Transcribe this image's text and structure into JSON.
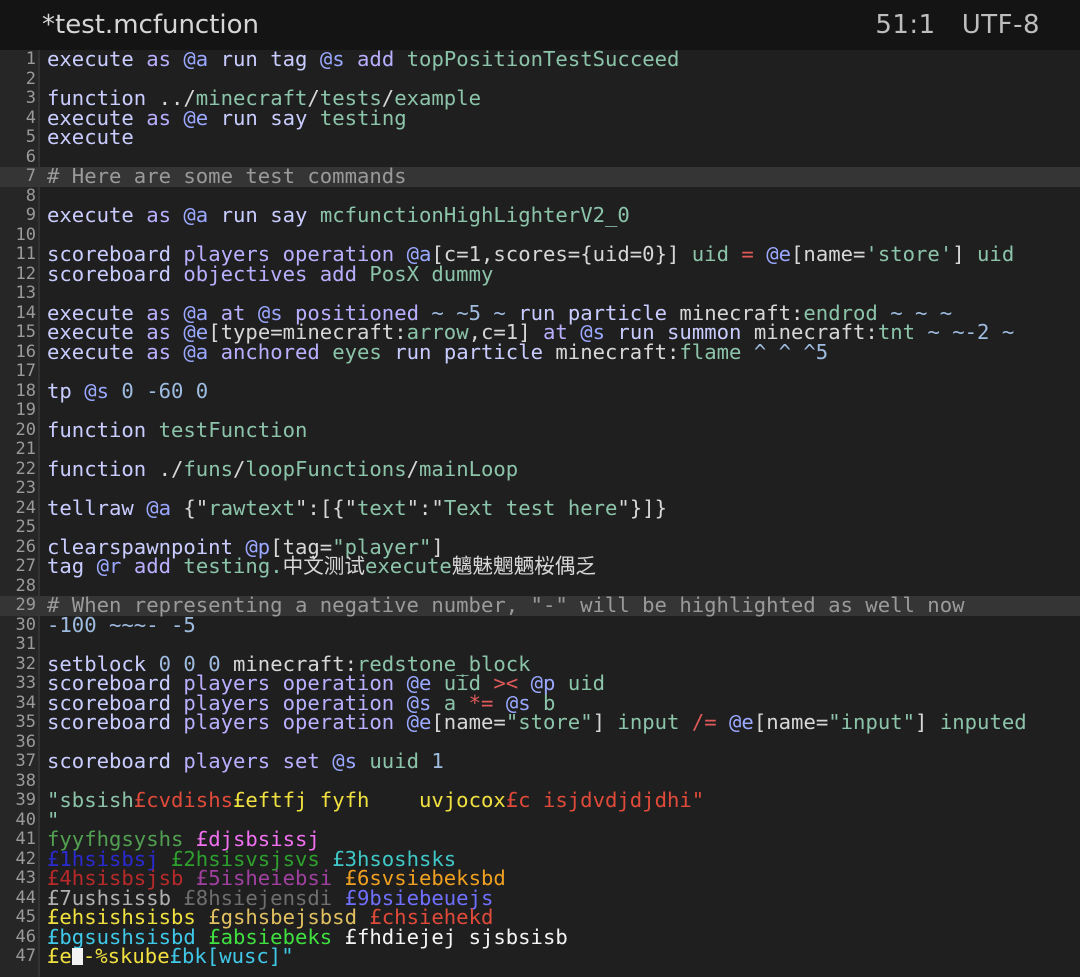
{
  "topbar": {
    "title": "*test.mcfunction",
    "position": "51:1",
    "encoding": "UTF-8"
  },
  "colors": {
    "keyword": "#b8b0ff",
    "command": "#ced2ff",
    "selector": "#9aa8ff",
    "func": "#8cc4aa",
    "number": "#9ebce0",
    "string": "#d2d2d2",
    "operator": "#e05a5a",
    "comment": "#a0a0a0"
  },
  "lines": [
    {
      "n": 1,
      "segs": [
        [
          "execute ",
          "#c9ccff"
        ],
        [
          "as ",
          "#b8b0ff"
        ],
        [
          "@a ",
          "#9aa8ff"
        ],
        [
          "run ",
          "#c9ccff"
        ],
        [
          "tag ",
          "#c9ccff"
        ],
        [
          "@s ",
          "#9aa8ff"
        ],
        [
          "add ",
          "#b8b0ff"
        ],
        [
          "topPositionTestSucceed",
          "#8cc4aa"
        ]
      ]
    },
    {
      "n": 2,
      "segs": []
    },
    {
      "n": 3,
      "segs": [
        [
          "function ",
          "#c9ccff"
        ],
        [
          "../",
          "#d7d7d7"
        ],
        [
          "minecraft",
          "#8cc4aa"
        ],
        [
          "/",
          "#d7d7d7"
        ],
        [
          "tests",
          "#8cc4aa"
        ],
        [
          "/",
          "#d7d7d7"
        ],
        [
          "example",
          "#8cc4aa"
        ]
      ]
    },
    {
      "n": 4,
      "segs": [
        [
          "execute ",
          "#c9ccff"
        ],
        [
          "as ",
          "#b8b0ff"
        ],
        [
          "@e ",
          "#9aa8ff"
        ],
        [
          "run ",
          "#c9ccff"
        ],
        [
          "say ",
          "#c9ccff"
        ],
        [
          "testing",
          "#8cc4aa"
        ]
      ]
    },
    {
      "n": 5,
      "segs": [
        [
          "execute",
          "#c9ccff"
        ]
      ]
    },
    {
      "n": 6,
      "segs": []
    },
    {
      "n": 7,
      "hl": true,
      "segs": [
        [
          "# Here are some test commands",
          "#9a9a9a"
        ]
      ]
    },
    {
      "n": 8,
      "segs": []
    },
    {
      "n": 9,
      "segs": [
        [
          "execute ",
          "#c9ccff"
        ],
        [
          "as ",
          "#b8b0ff"
        ],
        [
          "@a ",
          "#9aa8ff"
        ],
        [
          "run ",
          "#c9ccff"
        ],
        [
          "say ",
          "#c9ccff"
        ],
        [
          "mcfunctionHighLighterV2_0",
          "#8cc4aa"
        ]
      ]
    },
    {
      "n": 10,
      "segs": []
    },
    {
      "n": 11,
      "segs": [
        [
          "scoreboard ",
          "#c9ccff"
        ],
        [
          "players ",
          "#b8b0ff"
        ],
        [
          "operation ",
          "#b8b0ff"
        ],
        [
          "@a",
          "#9aa8ff"
        ],
        [
          "[c=1,scores={uid=0}] ",
          "#d7d7d7"
        ],
        [
          "uid ",
          "#8cc4aa"
        ],
        [
          "= ",
          "#e05a5a"
        ],
        [
          "@e",
          "#9aa8ff"
        ],
        [
          "[name=",
          "#d7d7d7"
        ],
        [
          "'store'",
          "#8cc4aa"
        ],
        [
          "] ",
          "#d7d7d7"
        ],
        [
          "uid",
          "#8cc4aa"
        ]
      ]
    },
    {
      "n": 12,
      "segs": [
        [
          "scoreboard ",
          "#c9ccff"
        ],
        [
          "objectives ",
          "#b8b0ff"
        ],
        [
          "add ",
          "#b8b0ff"
        ],
        [
          "PosX dummy",
          "#8cc4aa"
        ]
      ]
    },
    {
      "n": 13,
      "segs": []
    },
    {
      "n": 14,
      "segs": [
        [
          "execute ",
          "#c9ccff"
        ],
        [
          "as ",
          "#b8b0ff"
        ],
        [
          "@a ",
          "#9aa8ff"
        ],
        [
          "at ",
          "#b8b0ff"
        ],
        [
          "@s ",
          "#9aa8ff"
        ],
        [
          "positioned ",
          "#b8b0ff"
        ],
        [
          "~ ~5 ~ ",
          "#9ebce0"
        ],
        [
          "run ",
          "#c9ccff"
        ],
        [
          "particle ",
          "#c9ccff"
        ],
        [
          "minecraft:",
          "#d7d7d7"
        ],
        [
          "endrod ",
          "#8cc4aa"
        ],
        [
          "~ ~ ~",
          "#9ebce0"
        ]
      ]
    },
    {
      "n": 15,
      "segs": [
        [
          "execute ",
          "#c9ccff"
        ],
        [
          "as ",
          "#b8b0ff"
        ],
        [
          "@e",
          "#9aa8ff"
        ],
        [
          "[type=minecraft:",
          "#d7d7d7"
        ],
        [
          "arrow",
          "#8cc4aa"
        ],
        [
          ",c=1] ",
          "#d7d7d7"
        ],
        [
          "at ",
          "#b8b0ff"
        ],
        [
          "@s ",
          "#9aa8ff"
        ],
        [
          "run ",
          "#c9ccff"
        ],
        [
          "summon ",
          "#c9ccff"
        ],
        [
          "minecraft:",
          "#d7d7d7"
        ],
        [
          "tnt ",
          "#8cc4aa"
        ],
        [
          "~ ~-2 ~",
          "#9ebce0"
        ]
      ]
    },
    {
      "n": 16,
      "segs": [
        [
          "execute ",
          "#c9ccff"
        ],
        [
          "as ",
          "#b8b0ff"
        ],
        [
          "@a ",
          "#9aa8ff"
        ],
        [
          "anchored ",
          "#b8b0ff"
        ],
        [
          "eyes ",
          "#8cc4aa"
        ],
        [
          "run ",
          "#c9ccff"
        ],
        [
          "particle ",
          "#c9ccff"
        ],
        [
          "minecraft:",
          "#d7d7d7"
        ],
        [
          "flame ",
          "#8cc4aa"
        ],
        [
          "^ ^ ^5",
          "#9ebce0"
        ]
      ]
    },
    {
      "n": 17,
      "segs": []
    },
    {
      "n": 18,
      "segs": [
        [
          "tp ",
          "#c9ccff"
        ],
        [
          "@s ",
          "#9aa8ff"
        ],
        [
          "0 -60 0",
          "#9ebce0"
        ]
      ]
    },
    {
      "n": 19,
      "segs": []
    },
    {
      "n": 20,
      "segs": [
        [
          "function ",
          "#c9ccff"
        ],
        [
          "testFunction",
          "#8cc4aa"
        ]
      ]
    },
    {
      "n": 21,
      "segs": []
    },
    {
      "n": 22,
      "segs": [
        [
          "function ",
          "#c9ccff"
        ],
        [
          "./",
          "#d7d7d7"
        ],
        [
          "funs",
          "#8cc4aa"
        ],
        [
          "/",
          "#d7d7d7"
        ],
        [
          "loopFunctions",
          "#8cc4aa"
        ],
        [
          "/",
          "#d7d7d7"
        ],
        [
          "mainLoop",
          "#8cc4aa"
        ]
      ]
    },
    {
      "n": 23,
      "segs": []
    },
    {
      "n": 24,
      "segs": [
        [
          "tellraw ",
          "#c9ccff"
        ],
        [
          "@a ",
          "#9aa8ff"
        ],
        [
          "{\"",
          "#d7d7d7"
        ],
        [
          "rawtext",
          "#8cc4aa"
        ],
        [
          "\":[{\"",
          "#d7d7d7"
        ],
        [
          "text",
          "#8cc4aa"
        ],
        [
          "\":\"",
          "#d7d7d7"
        ],
        [
          "Text test here",
          "#8cc4aa"
        ],
        [
          "\"}]}",
          "#d7d7d7"
        ]
      ]
    },
    {
      "n": 25,
      "segs": []
    },
    {
      "n": 26,
      "segs": [
        [
          "clearspawnpoint ",
          "#c9ccff"
        ],
        [
          "@p",
          "#9aa8ff"
        ],
        [
          "[tag=",
          "#d7d7d7"
        ],
        [
          "\"player\"",
          "#8cc4aa"
        ],
        [
          "]",
          "#d7d7d7"
        ]
      ]
    },
    {
      "n": 27,
      "segs": [
        [
          "tag ",
          "#c9ccff"
        ],
        [
          "@r ",
          "#9aa8ff"
        ],
        [
          "add ",
          "#b8b0ff"
        ],
        [
          "testing.",
          "#8cc4aa"
        ],
        [
          "中文测试",
          "#d7d7d7"
        ],
        [
          "execute",
          "#8cc4aa"
        ],
        [
          "魑魅魍魉桜偶乏",
          "#d7d7d7"
        ]
      ]
    },
    {
      "n": 28,
      "segs": []
    },
    {
      "n": 29,
      "hl": true,
      "segs": [
        [
          "# When representing a negative number, \"-\" will be highlighted as well now",
          "#9a9a9a"
        ]
      ]
    },
    {
      "n": 30,
      "segs": [
        [
          "-100 ~~~- -5",
          "#9ebce0"
        ]
      ]
    },
    {
      "n": 31,
      "segs": []
    },
    {
      "n": 32,
      "segs": [
        [
          "setblock ",
          "#c9ccff"
        ],
        [
          "0 0 0 ",
          "#9ebce0"
        ],
        [
          "minecraft:",
          "#d7d7d7"
        ],
        [
          "redstone_block",
          "#8cc4aa"
        ]
      ]
    },
    {
      "n": 33,
      "segs": [
        [
          "scoreboard ",
          "#c9ccff"
        ],
        [
          "players ",
          "#b8b0ff"
        ],
        [
          "operation ",
          "#b8b0ff"
        ],
        [
          "@e ",
          "#9aa8ff"
        ],
        [
          "uid ",
          "#8cc4aa"
        ],
        [
          ">< ",
          "#e05a5a"
        ],
        [
          "@p ",
          "#9aa8ff"
        ],
        [
          "uid",
          "#8cc4aa"
        ]
      ]
    },
    {
      "n": 34,
      "segs": [
        [
          "scoreboard ",
          "#c9ccff"
        ],
        [
          "players ",
          "#b8b0ff"
        ],
        [
          "operation ",
          "#b8b0ff"
        ],
        [
          "@s ",
          "#9aa8ff"
        ],
        [
          "a ",
          "#8cc4aa"
        ],
        [
          "*= ",
          "#e05a5a"
        ],
        [
          "@s ",
          "#9aa8ff"
        ],
        [
          "b",
          "#8cc4aa"
        ]
      ]
    },
    {
      "n": 35,
      "segs": [
        [
          "scoreboard ",
          "#c9ccff"
        ],
        [
          "players ",
          "#b8b0ff"
        ],
        [
          "operation ",
          "#b8b0ff"
        ],
        [
          "@e",
          "#9aa8ff"
        ],
        [
          "[name=",
          "#d7d7d7"
        ],
        [
          "\"store\"",
          "#8cc4aa"
        ],
        [
          "] ",
          "#d7d7d7"
        ],
        [
          "input ",
          "#8cc4aa"
        ],
        [
          "/= ",
          "#e05a5a"
        ],
        [
          "@e",
          "#9aa8ff"
        ],
        [
          "[name=",
          "#d7d7d7"
        ],
        [
          "\"input\"",
          "#8cc4aa"
        ],
        [
          "] ",
          "#d7d7d7"
        ],
        [
          "inputed",
          "#8cc4aa"
        ]
      ]
    },
    {
      "n": 36,
      "segs": []
    },
    {
      "n": 37,
      "segs": [
        [
          "scoreboard ",
          "#c9ccff"
        ],
        [
          "players ",
          "#b8b0ff"
        ],
        [
          "set ",
          "#b8b0ff"
        ],
        [
          "@s ",
          "#9aa8ff"
        ],
        [
          "uuid ",
          "#8cc4aa"
        ],
        [
          "1",
          "#9ebce0"
        ]
      ]
    },
    {
      "n": 38,
      "segs": []
    },
    {
      "n": 39,
      "segs": [
        [
          "\"sbsish",
          "#8cc4aa"
        ],
        [
          "£cvdishs",
          "#e04a3a"
        ],
        [
          "£eftfj fyfh    ",
          "#f0e040"
        ],
        [
          "uvjocox",
          "#f0e040"
        ],
        [
          "£c isjdvdjdjdhi\"",
          "#e04a3a"
        ]
      ]
    },
    {
      "n": 40,
      "segs": [
        [
          "\"",
          "#8cc4aa"
        ]
      ]
    },
    {
      "n": 41,
      "segs": [
        [
          "fyyfhgsyshs ",
          "#52a052"
        ],
        [
          "£djsbsissj",
          "#f070f0"
        ]
      ]
    },
    {
      "n": 42,
      "segs": [
        [
          "£1hsisbsj ",
          "#2a2ad0"
        ],
        [
          "£2hsisvsjsvs ",
          "#2ea02e"
        ],
        [
          "£3hsoshsks",
          "#40c8c8"
        ]
      ]
    },
    {
      "n": 43,
      "segs": [
        [
          "£4hsisbsjsb ",
          "#b82a2a"
        ],
        [
          "£5isheiebsi ",
          "#a040a0"
        ],
        [
          "£6svsiebeksbd",
          "#f0a020"
        ]
      ]
    },
    {
      "n": 44,
      "segs": [
        [
          "£7ushsissb ",
          "#b0b0b0"
        ],
        [
          "£8hsiejensdi ",
          "#6e6e6e"
        ],
        [
          "£9bsiebeuejs",
          "#7070ff"
        ]
      ]
    },
    {
      "n": 45,
      "segs": [
        [
          "£ehsishsisbs ",
          "#f0e040"
        ],
        [
          "£gshsbejsbsd ",
          "#e0c060"
        ],
        [
          "£chsiehekd",
          "#e04a3a"
        ]
      ]
    },
    {
      "n": 46,
      "segs": [
        [
          "£bgsushsisbd ",
          "#40c8e8"
        ],
        [
          "£absiebeks ",
          "#40e040"
        ],
        [
          "£fhdiejej sjsbsisb",
          "#f4f4f4"
        ]
      ]
    },
    {
      "n": 47,
      "cursor": true,
      "segs": [
        [
          "£e",
          "#f0e040"
        ],
        [
          "CURSOR",
          "#ffffff"
        ],
        [
          "-%skube",
          "#f0e040"
        ],
        [
          "£bk[wusc]\"",
          "#40c8e8"
        ]
      ]
    }
  ]
}
